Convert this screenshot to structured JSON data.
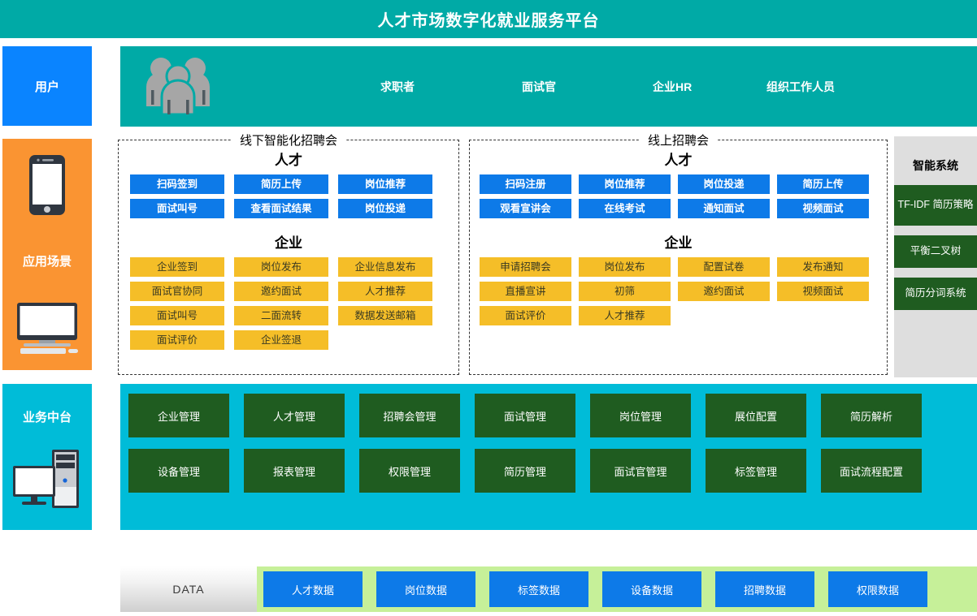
{
  "header": {
    "title": "人才市场数字化就业服务平台",
    "bg_color": "#00aaa6"
  },
  "rail": {
    "user": {
      "label": "用户",
      "color": "#0a84ff",
      "icon": "user-block"
    },
    "scene": {
      "label": "应用场景",
      "color": "#fa9432",
      "icons": [
        "mobile-phone-icon",
        "desktop-monitor-icon"
      ]
    },
    "middle_platform": {
      "label": "业务中台",
      "color": "#00bcd8",
      "icon": "server-computer-icon"
    }
  },
  "users_band": {
    "icon": "group-of-people-icon",
    "bg_color": "#00aaa6",
    "roles": [
      "求职者",
      "面试官",
      "企业HR",
      "组织工作人员"
    ]
  },
  "panels": [
    {
      "id": "offline",
      "title": "线下智能化招聘会",
      "groups": [
        {
          "heading": "人才",
          "style": "blue",
          "color": "#0d7ae8",
          "items": [
            "扫码签到",
            "简历上传",
            "岗位推荐",
            "面试叫号",
            "查看面试结果",
            "岗位投递"
          ]
        },
        {
          "heading": "企业",
          "style": "gold",
          "color": "#f5be28",
          "items": [
            "企业签到",
            "岗位发布",
            "企业信息发布",
            "面试官协同",
            "邀约面试",
            "人才推荐",
            "面试叫号",
            "二面流转",
            "数据发送邮箱",
            "面试评价",
            "企业签退"
          ]
        }
      ]
    },
    {
      "id": "online",
      "title": "线上招聘会",
      "groups": [
        {
          "heading": "人才",
          "style": "blue",
          "color": "#0d7ae8",
          "items": [
            "扫码注册",
            "岗位推荐",
            "岗位投递",
            "简历上传",
            "观看宣讲会",
            "在线考试",
            "通知面试",
            "视频面试"
          ]
        },
        {
          "heading": "企业",
          "style": "gold",
          "color": "#f5be28",
          "items": [
            "申请招聘会",
            "岗位发布",
            "配置试卷",
            "发布通知",
            "直播宣讲",
            "初筛",
            "邀约面试",
            "视频面试",
            "面试评价",
            "人才推荐"
          ]
        }
      ]
    }
  ],
  "ai_system": {
    "title": "智能系统",
    "bg_color": "#dedede",
    "box_color": "#1f5c20",
    "boxes": [
      "TF-IDF\n简历策略",
      "平衡二叉树",
      "简历分词系统"
    ],
    "boxes_flat": [
      "TF-IDF 简历策略",
      "平衡二叉树",
      "简历分词系统"
    ]
  },
  "business_platform": {
    "bg_color": "#00bcd8",
    "box_color": "#1f5c20",
    "items": [
      "企业管理",
      "人才管理",
      "招聘会管理",
      "面试管理",
      "岗位管理",
      "展位配置",
      "简历解析",
      "设备管理",
      "报表管理",
      "权限管理",
      "简历管理",
      "面试官管理",
      "标签管理",
      "面试流程配置"
    ]
  },
  "data_layer": {
    "label": "DATA",
    "strip_color": "#c6f099",
    "box_color": "#0d7ae8",
    "items": [
      "人才数据",
      "岗位数据",
      "标签数据",
      "设备数据",
      "招聘数据",
      "权限数据"
    ]
  }
}
